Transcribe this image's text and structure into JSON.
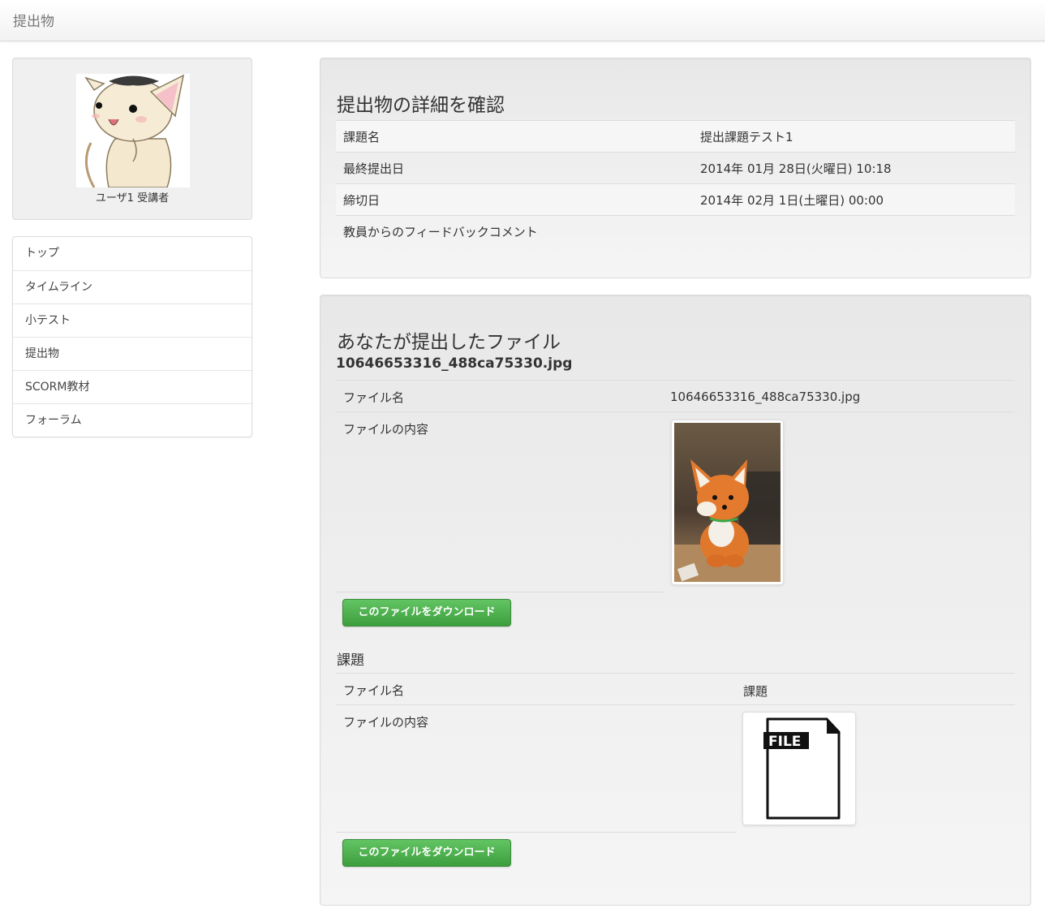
{
  "navbar": {
    "brand": "提出物"
  },
  "profile": {
    "name": "ユーザ1 受講者"
  },
  "sidebar": {
    "items": [
      {
        "label": "トップ"
      },
      {
        "label": "タイムライン"
      },
      {
        "label": "小テスト"
      },
      {
        "label": "提出物"
      },
      {
        "label": "SCORM教材"
      },
      {
        "label": "フォーラム"
      }
    ]
  },
  "details": {
    "heading": "提出物の詳細を確認",
    "rows": [
      {
        "label": "課題名",
        "value": "提出課題テスト1"
      },
      {
        "label": "最終提出日",
        "value": "2014年 01月 28日(火曜日) 10:18"
      },
      {
        "label": "締切日",
        "value": "2014年 02月 1日(土曜日) 00:00"
      },
      {
        "label": "教員からのフィードバックコメント",
        "value": ""
      }
    ]
  },
  "submitted": {
    "heading": "あなたが提出したファイル",
    "filename_heading": "10646653316_488ca75330.jpg",
    "file_name_label": "ファイル名",
    "file_name_value": "10646653316_488ca75330.jpg",
    "file_content_label": "ファイルの内容",
    "download_label": "このファイルをダウンロード"
  },
  "assignment": {
    "heading": "課題",
    "file_name_label": "ファイル名",
    "file_name_value": "課題",
    "file_content_label": "ファイルの内容",
    "file_icon_text": "FILE",
    "download_label": "このファイルをダウンロード"
  },
  "colors": {
    "download_button": "#4cae4c",
    "well_bg": "#efefef"
  }
}
